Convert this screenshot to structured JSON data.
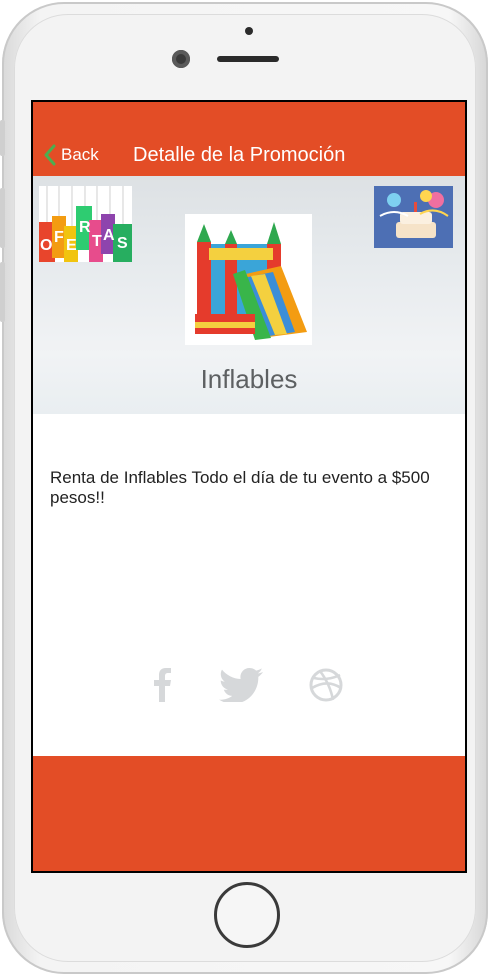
{
  "navbar": {
    "back_label": "Back",
    "title": "Detalle de la Promoción"
  },
  "hero": {
    "left_banner_text": "OFERTAS",
    "product_name": "Inflables"
  },
  "promotion": {
    "description": "Renta de Inflables Todo el día de tu evento a $500 pesos!!"
  },
  "social": {
    "icons": [
      "facebook-icon",
      "twitter-icon",
      "dribbble-icon"
    ]
  },
  "colors": {
    "accent": "#e34d26",
    "back_chevron": "#4caf50",
    "social_icon": "#d6d8da"
  }
}
